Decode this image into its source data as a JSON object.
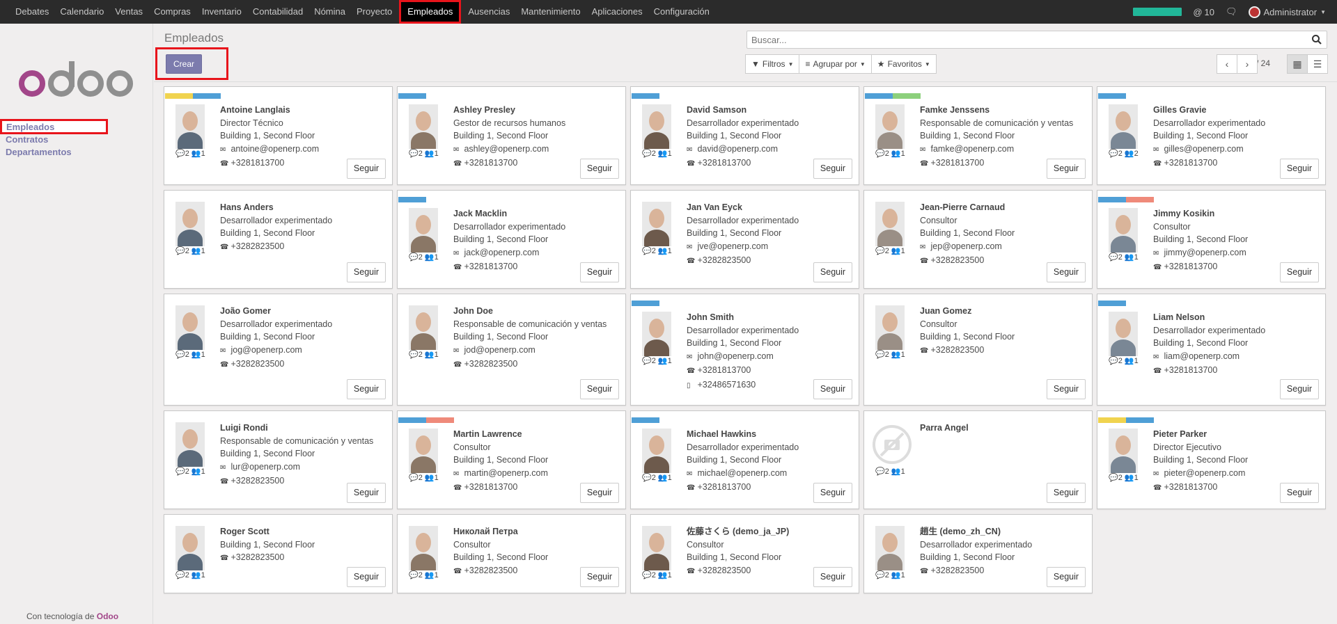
{
  "topbar": {
    "menu": [
      "Debates",
      "Calendario",
      "Ventas",
      "Compras",
      "Inventario",
      "Contabilidad",
      "Nómina",
      "Proyecto",
      "Empleados",
      "Ausencias",
      "Mantenimiento",
      "Aplicaciones",
      "Configuración"
    ],
    "active_menu": "Empleados",
    "progress": 1.0,
    "notifications": "10",
    "user": "Administrator",
    "accent": "#21b799"
  },
  "sidebar": {
    "brand": "odoo",
    "items": [
      "Empleados",
      "Contratos",
      "Departamentos"
    ],
    "powered_prefix": "Con tecnología de",
    "powered_brand": "Odoo"
  },
  "control": {
    "title": "Empleados",
    "create_label": "Crear",
    "search_placeholder": "Buscar...",
    "filters_label": "Filtros",
    "groupby_label": "Agrupar por",
    "favorites_label": "Favoritos",
    "pager": "1-24 / 24"
  },
  "follow_label": "Seguir",
  "tag_colors": {
    "blue": "#4f9fd6",
    "yellow": "#f0d34f",
    "green": "#8cd07c",
    "red": "#ef8a7a"
  },
  "employees": [
    {
      "name": "Antoine Langlais",
      "job": "Director Técnico",
      "location": "Building 1, Second Floor",
      "email": "antoine@openerp.com",
      "phone": "+3281813700",
      "msgs": "2",
      "followers": "1",
      "tags": [
        "yellow",
        "blue"
      ]
    },
    {
      "name": "Ashley Presley",
      "job": "Gestor de recursos humanos",
      "location": "Building 1, Second Floor",
      "email": "ashley@openerp.com",
      "phone": "+3281813700",
      "msgs": "2",
      "followers": "1",
      "tags": [
        "blue"
      ]
    },
    {
      "name": "David Samson",
      "job": "Desarrollador experimentado",
      "location": "Building 1, Second Floor",
      "email": "david@openerp.com",
      "phone": "+3281813700",
      "msgs": "2",
      "followers": "1",
      "tags": [
        "blue"
      ]
    },
    {
      "name": "Famke Jenssens",
      "job": "Responsable de comunicación y ventas",
      "location": "Building 1, Second Floor",
      "email": "famke@openerp.com",
      "phone": "+3281813700",
      "msgs": "2",
      "followers": "1",
      "tags": [
        "blue",
        "green"
      ]
    },
    {
      "name": "Gilles Gravie",
      "job": "Desarrollador experimentado",
      "location": "Building 1, Second Floor",
      "email": "gilles@openerp.com",
      "phone": "+3281813700",
      "msgs": "2",
      "followers": "2",
      "tags": [
        "blue"
      ]
    },
    {
      "name": "Hans Anders",
      "job": "Desarrollador experimentado",
      "location": "Building 1, Second Floor",
      "email": "",
      "phone": "+3282823500",
      "msgs": "2",
      "followers": "1",
      "tags": []
    },
    {
      "name": "Jack Macklin",
      "job": "Desarrollador experimentado",
      "location": "Building 1, Second Floor",
      "email": "jack@openerp.com",
      "phone": "+3281813700",
      "msgs": "2",
      "followers": "1",
      "tags": [
        "blue"
      ]
    },
    {
      "name": "Jan Van Eyck",
      "job": "Desarrollador experimentado",
      "location": "Building 1, Second Floor",
      "email": "jve@openerp.com",
      "phone": "+3282823500",
      "msgs": "2",
      "followers": "1",
      "tags": []
    },
    {
      "name": "Jean-Pierre Carnaud",
      "job": "Consultor",
      "location": "Building 1, Second Floor",
      "email": "jep@openerp.com",
      "phone": "+3282823500",
      "msgs": "2",
      "followers": "1",
      "tags": []
    },
    {
      "name": "Jimmy Kosikin",
      "job": "Consultor",
      "location": "Building 1, Second Floor",
      "email": "jimmy@openerp.com",
      "phone": "+3281813700",
      "msgs": "2",
      "followers": "1",
      "tags": [
        "blue",
        "red"
      ]
    },
    {
      "name": "João Gomer",
      "job": "Desarrollador experimentado",
      "location": "Building 1, Second Floor",
      "email": "jog@openerp.com",
      "phone": "+3282823500",
      "msgs": "2",
      "followers": "1",
      "tags": []
    },
    {
      "name": "John Doe",
      "job": "Responsable de comunicación y ventas",
      "location": "Building 1, Second Floor",
      "email": "jod@openerp.com",
      "phone": "+3282823500",
      "msgs": "2",
      "followers": "1",
      "tags": []
    },
    {
      "name": "John Smith",
      "job": "Desarrollador experimentado",
      "location": "Building 1, Second Floor",
      "email": "john@openerp.com",
      "phone": "+3281813700",
      "mobile": "+32486571630",
      "msgs": "2",
      "followers": "1",
      "tags": [
        "blue"
      ]
    },
    {
      "name": "Juan Gomez",
      "job": "Consultor",
      "location": "Building 1, Second Floor",
      "email": "",
      "phone": "+3282823500",
      "msgs": "2",
      "followers": "1",
      "tags": []
    },
    {
      "name": "Liam Nelson",
      "job": "Desarrollador experimentado",
      "location": "Building 1, Second Floor",
      "email": "liam@openerp.com",
      "phone": "+3281813700",
      "msgs": "2",
      "followers": "1",
      "tags": [
        "blue"
      ]
    },
    {
      "name": "Luigi Rondi",
      "job": "Responsable de comunicación y ventas",
      "location": "Building 1, Second Floor",
      "email": "lur@openerp.com",
      "phone": "+3282823500",
      "msgs": "2",
      "followers": "1",
      "tags": []
    },
    {
      "name": "Martin Lawrence",
      "job": "Consultor",
      "location": "Building 1, Second Floor",
      "email": "martin@openerp.com",
      "phone": "+3281813700",
      "msgs": "2",
      "followers": "1",
      "tags": [
        "blue",
        "red"
      ]
    },
    {
      "name": "Michael Hawkins",
      "job": "Desarrollador experimentado",
      "location": "Building 1, Second Floor",
      "email": "michael@openerp.com",
      "phone": "+3281813700",
      "msgs": "2",
      "followers": "1",
      "tags": [
        "blue"
      ]
    },
    {
      "name": "Parra Angel",
      "job": "",
      "location": "",
      "email": "",
      "phone": "",
      "msgs": "2",
      "followers": "1",
      "tags": [],
      "nophoto": true
    },
    {
      "name": "Pieter Parker",
      "job": "Director Ejecutivo",
      "location": "Building 1, Second Floor",
      "email": "pieter@openerp.com",
      "phone": "+3281813700",
      "msgs": "2",
      "followers": "1",
      "tags": [
        "yellow",
        "blue"
      ]
    },
    {
      "name": "Roger Scott",
      "job": "",
      "location": "Building 1, Second Floor",
      "email": "",
      "phone": "+3282823500",
      "msgs": "2",
      "followers": "1",
      "tags": []
    },
    {
      "name": "Николай Петра",
      "job": "Consultor",
      "location": "Building 1, Second Floor",
      "email": "",
      "phone": "+3282823500",
      "msgs": "2",
      "followers": "1",
      "tags": []
    },
    {
      "name": "佐藤さくら (demo_ja_JP)",
      "job": "Consultor",
      "location": "Building 1, Second Floor",
      "email": "",
      "phone": "+3282823500",
      "msgs": "2",
      "followers": "1",
      "tags": []
    },
    {
      "name": "趙生 (demo_zh_CN)",
      "job": "Desarrollador experimentado",
      "location": "Building 1, Second Floor",
      "email": "",
      "phone": "+3282823500",
      "msgs": "2",
      "followers": "1",
      "tags": []
    }
  ]
}
